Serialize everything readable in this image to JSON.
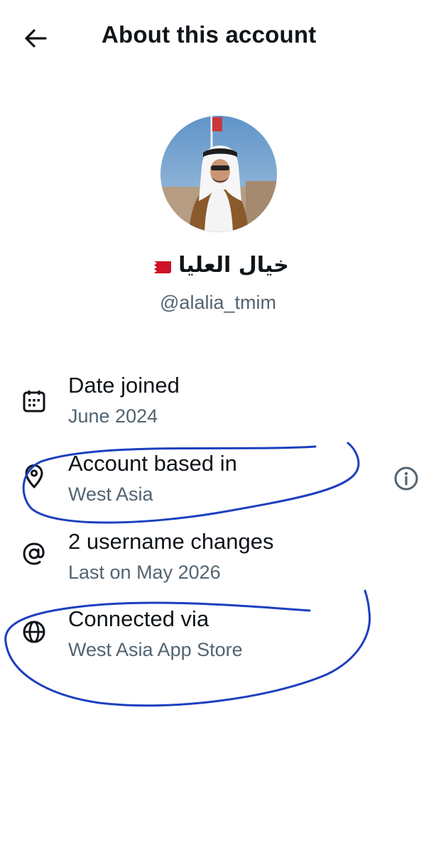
{
  "header": {
    "title": "About this account",
    "back_icon": "arrow-left-icon"
  },
  "profile": {
    "display_name": "خيال العليا",
    "flag_icon": "bahrain-flag-icon",
    "handle": "@alalia_tmim"
  },
  "details": [
    {
      "icon": "calendar-icon",
      "title": "Date joined",
      "value": "June 2024"
    },
    {
      "icon": "location-pin-icon",
      "title": "Account based in",
      "value": "West Asia",
      "info_icon": "info-circle-icon"
    },
    {
      "icon": "at-sign-icon",
      "title": "2 username changes",
      "value": "Last on May 2026"
    },
    {
      "icon": "globe-icon",
      "title": "Connected via",
      "value": "West Asia App Store"
    }
  ],
  "colors": {
    "text_primary": "#0f1419",
    "text_secondary": "#536471",
    "annotation_ink": "#1d3fbf",
    "flag_red": "#ce1126"
  }
}
